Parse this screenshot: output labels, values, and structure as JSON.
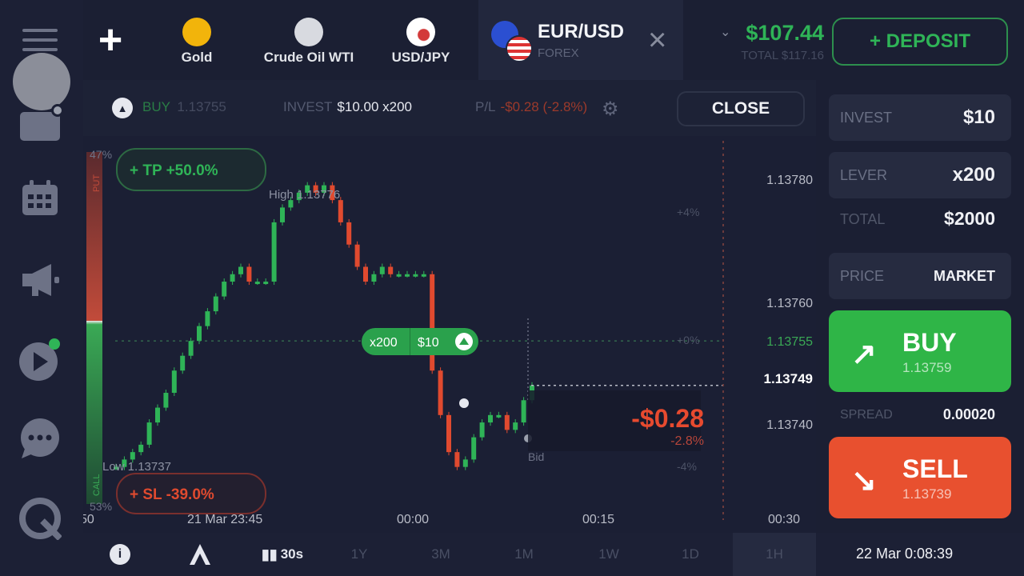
{
  "sidebar": {
    "items": [
      {
        "name": "menu-icon"
      },
      {
        "name": "avatar"
      },
      {
        "name": "briefcase-icon"
      },
      {
        "name": "calendar-icon"
      },
      {
        "name": "megaphone-icon"
      },
      {
        "name": "play-icon"
      },
      {
        "name": "chat-icon"
      },
      {
        "name": "support-icon"
      }
    ]
  },
  "topbar": {
    "add_icon": "+",
    "assets": [
      {
        "name": "Gold",
        "icon_color": "#f2b40b"
      },
      {
        "name": "Crude Oil WTI",
        "icon_color": "#d8dae0"
      },
      {
        "name": "USD/JPY",
        "icon_color": "#d33a3a"
      }
    ],
    "active": {
      "pair": "EUR/USD",
      "category": "FOREX",
      "close_icon": "×"
    },
    "balance": {
      "amount": "$107.44",
      "total": "TOTAL $117.16"
    },
    "deposit_label": "+ DEPOSIT"
  },
  "position": {
    "direction": "BUY",
    "open_price": "1.13755",
    "invest_label": "INVEST",
    "invest_value": "$10.00 x200",
    "pl_label": "P/L",
    "pl_value": "-$0.28 (-2.8%)",
    "close_label": "CLOSE"
  },
  "chart": {
    "tp_label": "+ TP  +50.0%",
    "sl_label": "+ SL  -39.0%",
    "high_label": "High 1.13776",
    "low_label": "Low 1.13737",
    "deal_badge": {
      "mult": "x200",
      "amount": "$10"
    },
    "current_price": "1.13749",
    "pnl_big": "-$0.28",
    "pnl_pct": "-2.8%",
    "bid_label": "Bid",
    "y_ticks": [
      "1.13780",
      "1.13760",
      "1.13755",
      "1.13740"
    ],
    "pct_ticks": [
      "+4%",
      "+0%",
      "-4%"
    ],
    "x_ticks": [
      "50",
      "21 Mar 23:45",
      "00:00",
      "00:15",
      "00:30"
    ],
    "left_pct_top": "47%",
    "left_pct_bottom": "53%",
    "left_put": "PUT",
    "left_call": "CALL"
  },
  "right_panel": {
    "invest": {
      "label": "INVEST",
      "value": "$10"
    },
    "lever": {
      "label": "LEVER",
      "value": "x200"
    },
    "total": {
      "label": "TOTAL",
      "value": "$2000"
    },
    "price": {
      "label": "PRICE",
      "value": "MARKET"
    },
    "buy": {
      "label": "BUY",
      "price": "1.13759"
    },
    "spread": {
      "label": "SPREAD",
      "value": "0.00020"
    },
    "sell": {
      "label": "SELL",
      "price": "1.13739"
    }
  },
  "bottombar": {
    "timeframes": [
      "30s",
      "1Y",
      "3M",
      "1M",
      "1W",
      "1D",
      "1H"
    ],
    "active_timeframe": "1H",
    "datetime": "22 Mar 0:08:39"
  },
  "colors": {
    "green": "#2fb457",
    "red": "#e74a2f",
    "bg": "#1b1f33"
  },
  "chart_data": {
    "type": "candlestick",
    "x_labels": [
      "21 Mar 23:45",
      "00:00",
      "00:15",
      "00:30"
    ],
    "series": [
      {
        "name": "EUR/USD",
        "close": [
          1.13738,
          1.13739,
          1.1374,
          1.13741,
          1.13744,
          1.13746,
          1.13748,
          1.13751,
          1.13753,
          1.13755,
          1.13757,
          1.13759,
          1.13761,
          1.13763,
          1.13764,
          1.13765,
          1.13763,
          1.13763,
          1.13763,
          1.13771,
          1.13773,
          1.13774,
          1.13775,
          1.13776,
          1.13775,
          1.13776,
          1.13774,
          1.13771,
          1.13768,
          1.13765,
          1.13763,
          1.13764,
          1.13765,
          1.13764,
          1.13764,
          1.13764,
          1.13764,
          1.13764,
          1.13751,
          1.13745,
          1.1374,
          1.13738,
          1.13739,
          1.13742,
          1.13744,
          1.13745,
          1.13745,
          1.13743,
          1.13744,
          1.13747,
          1.13749
        ]
      }
    ],
    "ylim": [
      1.13733,
      1.13782
    ],
    "open_price": 1.13755,
    "current_price": 1.13749
  }
}
